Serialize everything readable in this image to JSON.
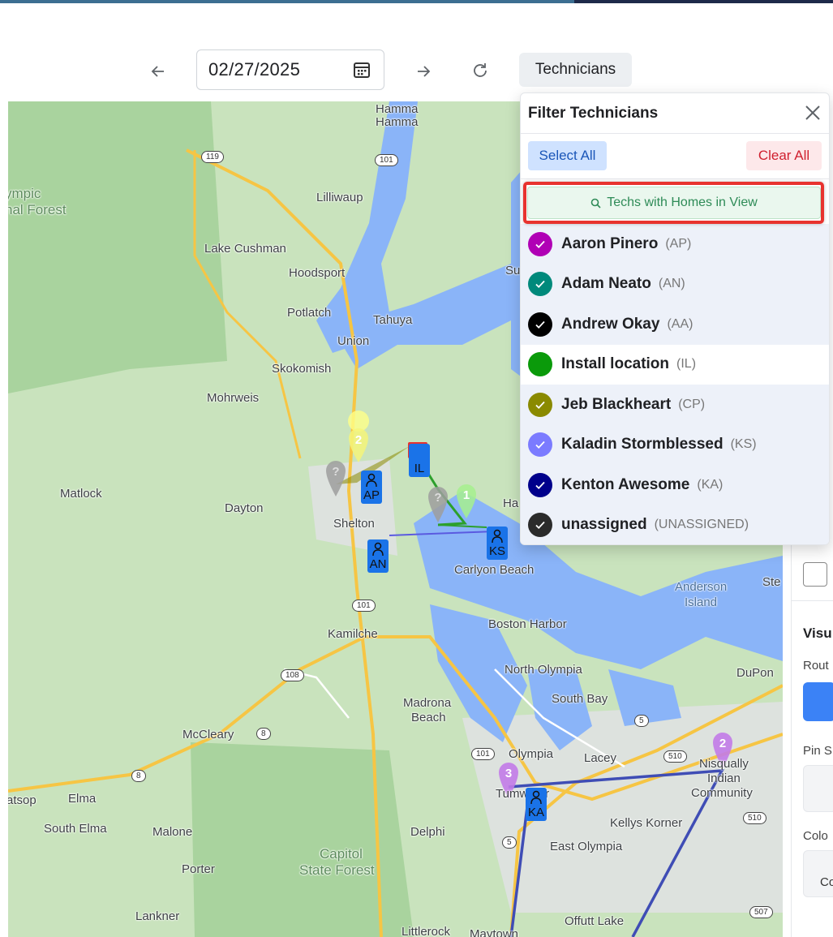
{
  "toolbar": {
    "prev_icon": "arrow-left-icon",
    "date_value": "02/27/2025",
    "calendar_icon": "calendar-icon",
    "next_icon": "arrow-right-icon",
    "refresh_icon": "refresh-icon",
    "technicians_label": "Technicians"
  },
  "popup": {
    "title": "Filter Technicians",
    "select_all": "Select All",
    "clear_all": "Clear All",
    "homes_in_view": "Techs with Homes in View",
    "technicians": [
      {
        "name": "Aaron Pinero",
        "code": "(AP)",
        "color": "#b000b5",
        "checked": true
      },
      {
        "name": "Adam Neato",
        "code": "(AN)",
        "color": "#00897b",
        "checked": true
      },
      {
        "name": "Andrew Okay",
        "code": "(AA)",
        "color": "#000000",
        "checked": true
      },
      {
        "name": "Install location",
        "code": "(IL)",
        "color": "#0a9a0a",
        "checked": false
      },
      {
        "name": "Jeb Blackheart",
        "code": "(CP)",
        "color": "#8a8a00",
        "checked": true
      },
      {
        "name": "Kaladin Stormblessed",
        "code": "(KS)",
        "color": "#7b7bff",
        "checked": true
      },
      {
        "name": "Kenton Awesome",
        "code": "(KA)",
        "color": "#00008b",
        "checked": true
      },
      {
        "name": "unassigned",
        "code": "(UNASSIGNED)",
        "color": "#2b2b2b",
        "checked": true
      }
    ]
  },
  "map": {
    "places": [
      "Hamma\nHamma",
      "Lilliwaup",
      "ympic",
      "nal Forest",
      "Lake Cushman",
      "Hoodsport",
      "Potlatch",
      "Tahuya",
      "Union",
      "Skokomish",
      "Mohrweis",
      "Matlock",
      "Dayton",
      "Shelton",
      "Carlyon Beach",
      "Kamilche",
      "Boston Harbor",
      "North Olympia",
      "South Bay",
      "Madrona",
      "Beach",
      "McCleary",
      "Olympia",
      "Lacey",
      "Tumwater",
      "Nisqually",
      "Indian",
      "Community",
      "Anderson",
      "Island",
      "DuPon",
      "Ste",
      "atsop",
      "Elma",
      "South Elma",
      "Malone",
      "Delphi",
      "East Olympia",
      "Kellys Korner",
      "Capitol",
      "State Forest",
      "Porter",
      "Lankner",
      "Littlerock",
      "Maytown",
      "Offutt Lake",
      "Su",
      "Ha"
    ],
    "highways": [
      "119",
      "101",
      "101",
      "108",
      "8",
      "8",
      "101",
      "510",
      "5",
      "5",
      "510",
      "507"
    ],
    "tech_pins": [
      "AP",
      "AN",
      "KS",
      "KA",
      "IL"
    ],
    "stop_numbers": [
      "2",
      "?",
      "?",
      "1",
      "3",
      "2"
    ]
  },
  "side_panel": {
    "visu": "Visu",
    "rout": "Rout",
    "pin_s": "Pin S",
    "colo": "Colo",
    "co": "Co"
  }
}
